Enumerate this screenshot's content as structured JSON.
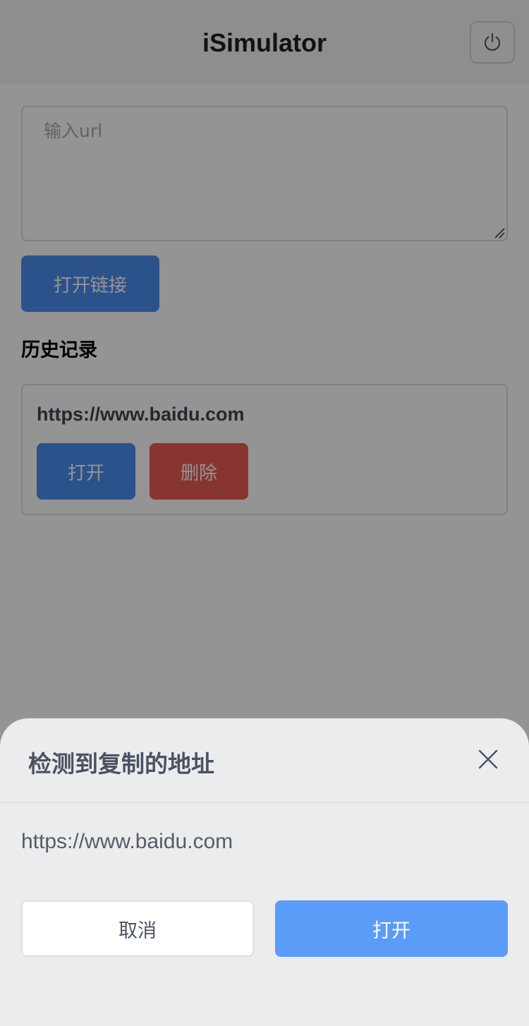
{
  "header": {
    "title": "iSimulator",
    "power_icon": "power-icon"
  },
  "url_input": {
    "placeholder": "输入url",
    "value": ""
  },
  "open_link_label": "打开链接",
  "history": {
    "heading": "历史记录",
    "items": [
      {
        "url": "https://www.baidu.com",
        "open_label": "打开",
        "delete_label": "删除"
      }
    ]
  },
  "sheet": {
    "title": "检测到复制的地址",
    "close_icon": "close-icon",
    "url": "https://www.baidu.com",
    "cancel_label": "取消",
    "confirm_label": "打开"
  },
  "colors": {
    "primary": "#4a8df0",
    "danger": "#ea5c57",
    "sheet_confirm": "#5b9cf8",
    "sheet_background": "#ebecee"
  }
}
